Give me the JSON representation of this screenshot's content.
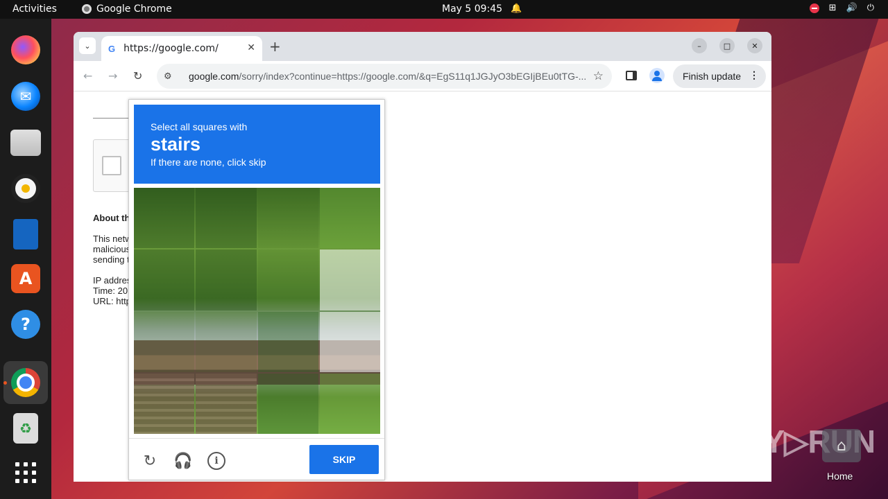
{
  "topbar": {
    "activities": "Activities",
    "app_name": "Google Chrome",
    "clock": "May 5  09:45"
  },
  "browser": {
    "tab_title": "https://google.com/",
    "tab_favicon": "G",
    "url_host": "google.com",
    "url_path": "/sorry/index?continue=https://google.com/&q=EgS11q1JGJyO3bEGIjBEu0tTG-...",
    "finish_update": "Finish update"
  },
  "page": {
    "about_heading": "About th",
    "para1": [
      "This netw",
      "malicious",
      "sending t"
    ],
    "para2": [
      "IP addres",
      "Time: 20",
      "URL: http"
    ]
  },
  "captcha": {
    "line1": "Select all squares with",
    "keyword": "stairs",
    "line3": "If there are none, click skip",
    "skip_label": "SKIP",
    "accent": "#1a73e8"
  },
  "desktop": {
    "home_label": "Home",
    "watermark": "ANY▷RUN"
  }
}
